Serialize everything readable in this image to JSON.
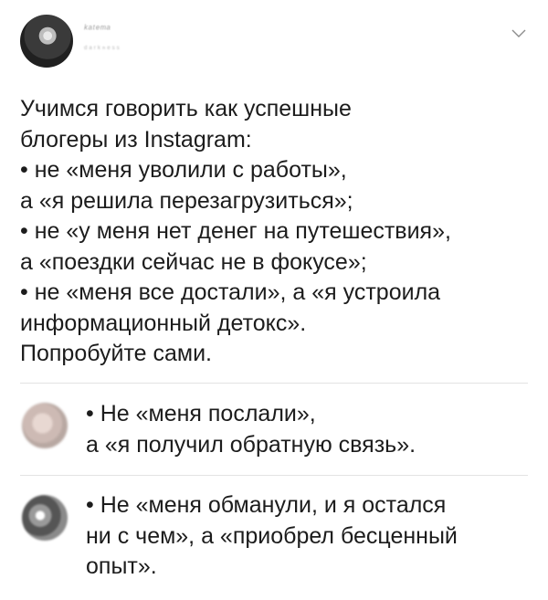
{
  "post": {
    "author_name": "ᵏᵃᵗᵉᵐᵃ",
    "author_handle": "ᵈᵃʳᵏⁿᵉˢˢ",
    "lines": [
      "Учимся говорить как успешные",
      "блогеры из Instagram:",
      "• не «меня уволили с работы»,",
      "а «я решила перезагрузиться»;",
      "• не «у меня нет денег на путешествия»,",
      "а «поездки сейчас не в фокусе»;",
      "• не «меня все достали», а «я устроила",
      "информационный детокс».",
      "Попробуйте сами."
    ]
  },
  "replies": [
    {
      "lines": [
        "• Не «меня послали»,",
        "а «я получил обратную связь»."
      ]
    },
    {
      "lines": [
        "• Не «меня обманули, и я остался",
        "ни с чем», а «приобрел бесценный",
        "опыт»."
      ]
    }
  ]
}
